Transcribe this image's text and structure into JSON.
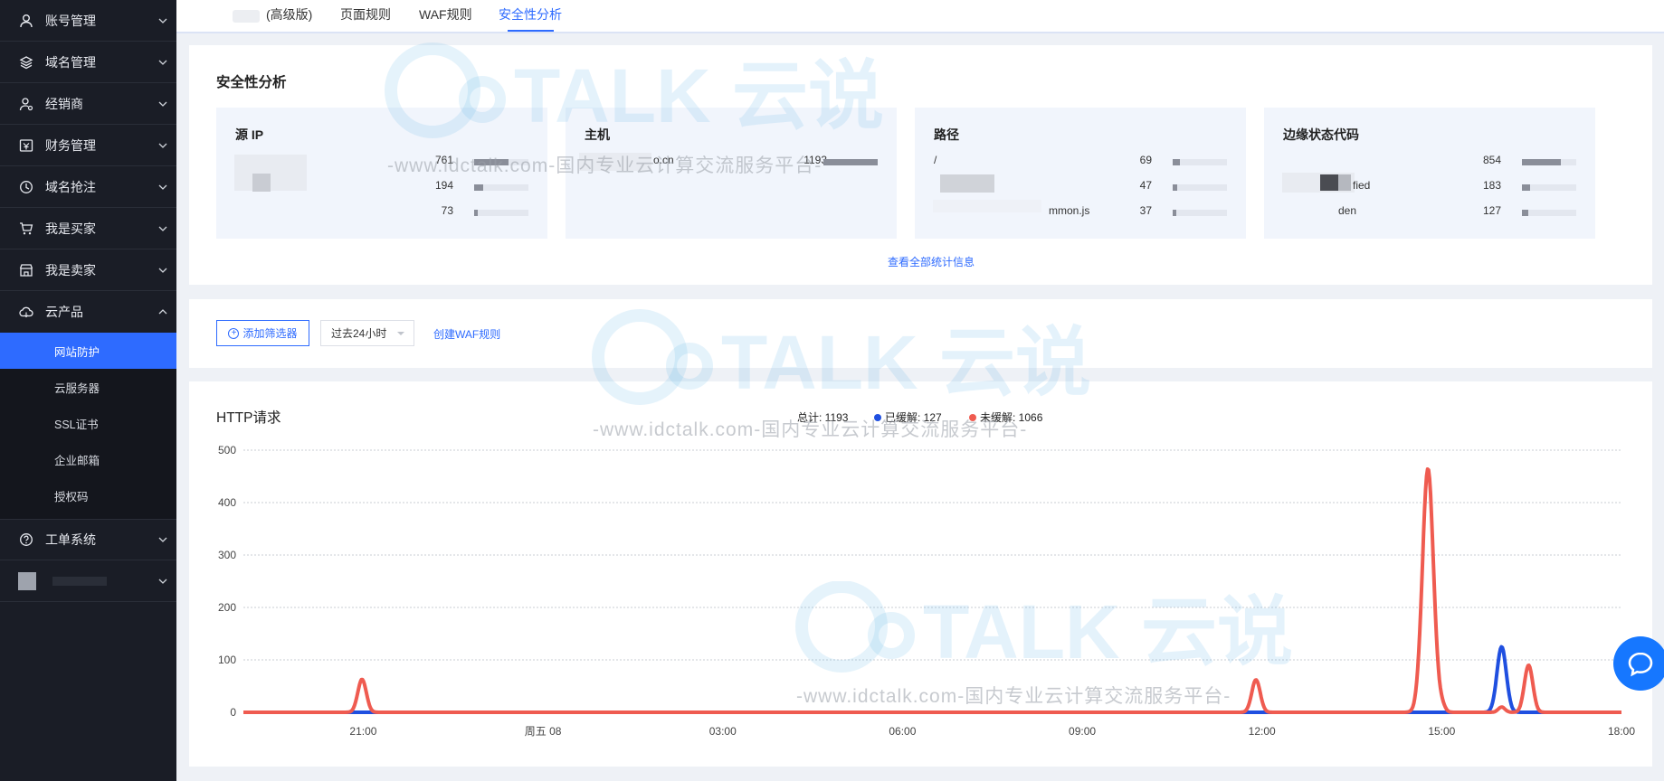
{
  "sidebar": {
    "items": [
      {
        "label": "账号管理",
        "icon": "user-icon"
      },
      {
        "label": "域名管理",
        "icon": "layers-icon"
      },
      {
        "label": "经销商",
        "icon": "partner-icon"
      },
      {
        "label": "财务管理",
        "icon": "finance-icon"
      },
      {
        "label": "域名抢注",
        "icon": "clock-icon"
      },
      {
        "label": "我是买家",
        "icon": "cart-icon"
      },
      {
        "label": "我是卖家",
        "icon": "store-icon"
      },
      {
        "label": "云产品",
        "icon": "cloud-icon"
      }
    ],
    "cloud_sub": [
      {
        "label": "网站防护",
        "active": true
      },
      {
        "label": "云服务器"
      },
      {
        "label": "SSL证书"
      },
      {
        "label": "企业邮箱"
      },
      {
        "label": "授权码"
      }
    ],
    "ticket": {
      "label": "工单系统",
      "icon": "question-icon"
    }
  },
  "tabs": {
    "items": [
      "(高级版)",
      "页面规则",
      "WAF规则",
      "安全性分析"
    ],
    "active": "安全性分析"
  },
  "security": {
    "title": "安全性分析",
    "cards": [
      {
        "title": "源 IP",
        "rows": [
          {
            "name": "",
            "value": "761",
            "ratio": 0.64
          },
          {
            "name": "",
            "value": "194",
            "ratio": 0.16
          },
          {
            "name": "",
            "value": "73",
            "ratio": 0.06
          }
        ]
      },
      {
        "title": "主机",
        "rows": [
          {
            "name": "o.cn",
            "value": "1193",
            "ratio": 1.0
          }
        ]
      },
      {
        "title": "路径",
        "rows": [
          {
            "name": "/",
            "value": "69",
            "ratio": 0.13
          },
          {
            "name": "",
            "value": "47",
            "ratio": 0.09
          },
          {
            "name": "mmon.js",
            "value": "37",
            "ratio": 0.07
          }
        ]
      },
      {
        "title": "边缘状态代码",
        "rows": [
          {
            "name": "",
            "value": "854",
            "ratio": 0.72
          },
          {
            "name": "fied",
            "value": "183",
            "ratio": 0.15
          },
          {
            "name": "den",
            "value": "127",
            "ratio": 0.11
          }
        ]
      }
    ],
    "view_all": "查看全部统计信息"
  },
  "filter": {
    "add_label": "添加筛选器",
    "time_value": "过去24小时",
    "waf_link": "创建WAF规则"
  },
  "http": {
    "title": "HTTP请求",
    "total_label": "总计: 1193",
    "cached_label": "已缓解: 127",
    "uncached_label": "未缓解: 1066"
  },
  "chart_data": {
    "type": "line",
    "title": "HTTP请求",
    "xlabel": "",
    "ylabel": "",
    "ylim": [
      0,
      500
    ],
    "yticks": [
      0,
      100,
      200,
      300,
      400,
      500
    ],
    "xlim": [
      19.0,
      42.0
    ],
    "xticks": [
      {
        "x": 21,
        "label": "21:00"
      },
      {
        "x": 24,
        "label": "周五 08"
      },
      {
        "x": 27,
        "label": "03:00"
      },
      {
        "x": 30,
        "label": "06:00"
      },
      {
        "x": 33,
        "label": "09:00"
      },
      {
        "x": 36,
        "label": "12:00"
      },
      {
        "x": 39,
        "label": "15:00"
      },
      {
        "x": 42,
        "label": "18:00"
      }
    ],
    "grid": true,
    "series": [
      {
        "name": "已缓解",
        "color": "#1f4fe0",
        "peaks": [
          {
            "x": 40.0,
            "y": 125,
            "w": 0.11
          }
        ]
      },
      {
        "name": "未缓解",
        "color": "#ef5b50",
        "peaks": [
          {
            "x": 20.98,
            "y": 63,
            "w": 0.1
          },
          {
            "x": 35.9,
            "y": 62,
            "w": 0.1
          },
          {
            "x": 38.77,
            "y": 465,
            "w": 0.13
          },
          {
            "x": 39.0,
            "y": 12,
            "w": 0.08
          },
          {
            "x": 40.0,
            "y": 10,
            "w": 0.08
          },
          {
            "x": 40.45,
            "y": 90,
            "w": 0.1
          }
        ]
      }
    ]
  },
  "watermark": {
    "brand": "TALK 云说",
    "sub": "-www.idctalk.com-国内专业云计算交流服务平台-"
  },
  "colors": {
    "accent": "#2e6bff",
    "sidebar_bg": "#1a1d26",
    "red_series": "#ef5b50",
    "blue_series": "#1f4fe0"
  }
}
